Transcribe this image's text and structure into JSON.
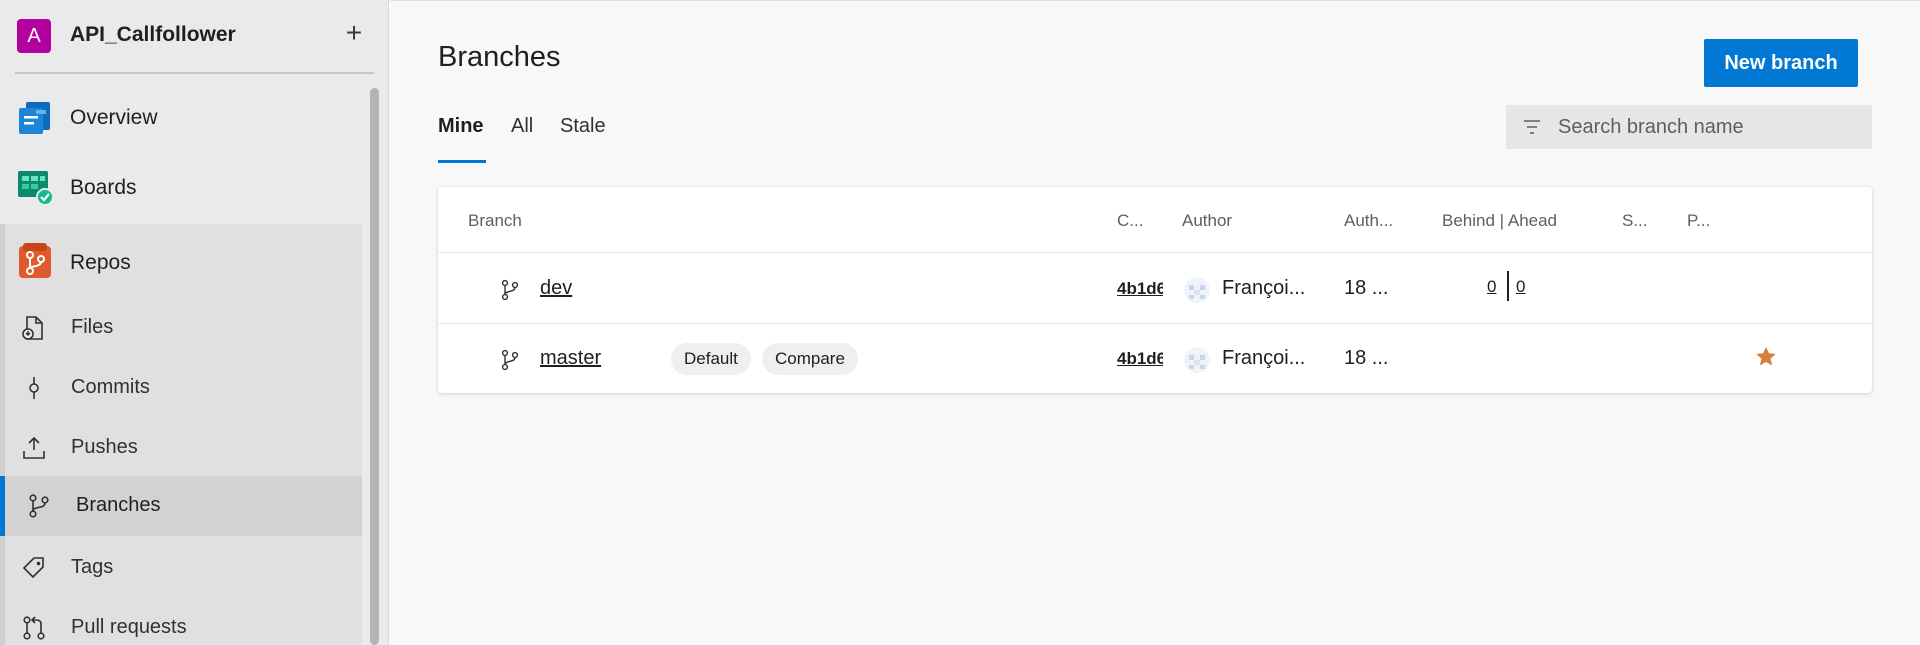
{
  "sidebar": {
    "project": {
      "avatar_letter": "A",
      "name": "API_Callfollower",
      "add_label": "+"
    },
    "nav": [
      {
        "label": "Overview",
        "icon": "overview-icon"
      },
      {
        "label": "Boards",
        "icon": "boards-icon"
      },
      {
        "label": "Repos",
        "icon": "repos-icon"
      }
    ],
    "repos_sub": [
      {
        "label": "Files",
        "icon": "files-icon"
      },
      {
        "label": "Commits",
        "icon": "commit-icon"
      },
      {
        "label": "Pushes",
        "icon": "push-icon"
      },
      {
        "label": "Branches",
        "icon": "branch-icon",
        "active": true
      },
      {
        "label": "Tags",
        "icon": "tag-icon"
      },
      {
        "label": "Pull requests",
        "icon": "pull-request-icon"
      }
    ]
  },
  "main": {
    "title": "Branches",
    "new_branch_label": "New branch",
    "tabs": [
      {
        "label": "Mine",
        "selected": true
      },
      {
        "label": "All",
        "selected": false
      },
      {
        "label": "Stale",
        "selected": false
      }
    ],
    "search": {
      "placeholder": "Search branch name",
      "value": ""
    },
    "table": {
      "headers": {
        "branch": "Branch",
        "commit": "C...",
        "author": "Author",
        "authored": "Auth...",
        "behind_ahead": "Behind | Ahead",
        "status": "S...",
        "pull_request": "P..."
      },
      "rows": [
        {
          "name": "dev",
          "commit": "4b1d6",
          "author": "Françoi...",
          "authored": "18 ...",
          "behind": "0",
          "ahead": "0",
          "badges": [],
          "starred": false
        },
        {
          "name": "master",
          "commit": "4b1d6",
          "author": "Françoi...",
          "authored": "18 ...",
          "behind": "",
          "ahead": "",
          "badges": [
            "Default",
            "Compare"
          ],
          "starred": true
        }
      ]
    }
  },
  "colors": {
    "accent": "#0078d4",
    "project_avatar": "#b4009e",
    "star": "#d67f3c"
  }
}
